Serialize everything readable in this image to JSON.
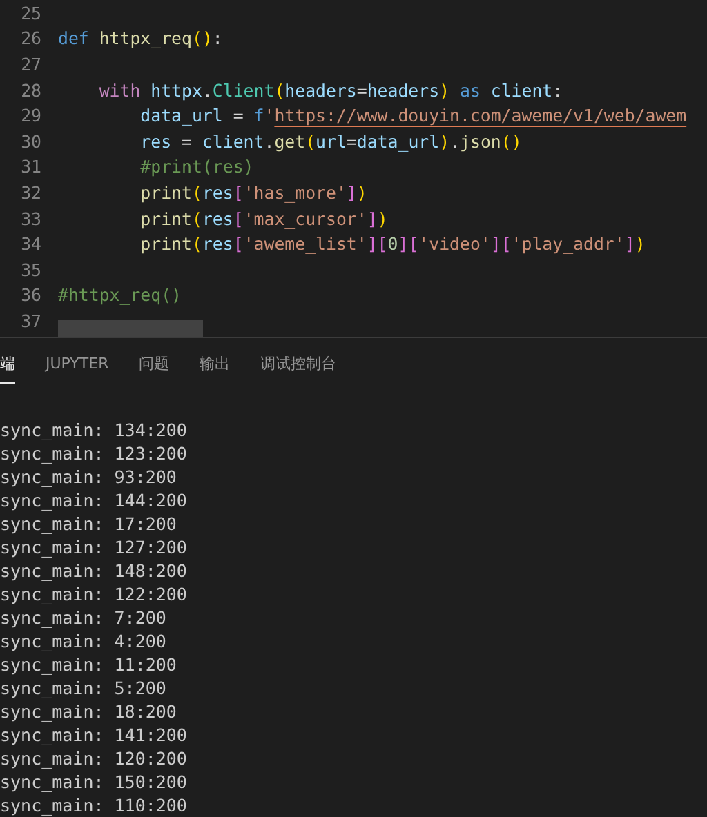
{
  "editor": {
    "lines": [
      {
        "number": "25"
      },
      {
        "number": "26",
        "tokens": [
          {
            "kind": "keyword",
            "text": "def "
          },
          {
            "kind": "function",
            "text": "httpx_req"
          },
          {
            "kind": "paren",
            "text": "()"
          },
          {
            "kind": "plain",
            "text": ":"
          }
        ]
      },
      {
        "number": "27"
      },
      {
        "number": "28",
        "tokens": [
          {
            "kind": "control",
            "text": "    with "
          },
          {
            "kind": "variable",
            "text": "httpx"
          },
          {
            "kind": "plain",
            "text": "."
          },
          {
            "kind": "class",
            "text": "Client"
          },
          {
            "kind": "paren",
            "text": "("
          },
          {
            "kind": "variable",
            "text": "headers"
          },
          {
            "kind": "plain",
            "text": "="
          },
          {
            "kind": "variable",
            "text": "headers"
          },
          {
            "kind": "paren",
            "text": ")"
          },
          {
            "kind": "keyword",
            "text": " as "
          },
          {
            "kind": "variable",
            "text": "client"
          },
          {
            "kind": "plain",
            "text": ":"
          }
        ]
      },
      {
        "number": "29",
        "tokens": [
          {
            "kind": "variable",
            "text": "        data_url"
          },
          {
            "kind": "plain",
            "text": " = "
          },
          {
            "kind": "keyword",
            "text": "f"
          },
          {
            "kind": "string",
            "text": "'"
          },
          {
            "kind": "link",
            "text": "https://www.douyin.com/aweme/v1/web/awem"
          }
        ]
      },
      {
        "number": "30",
        "tokens": [
          {
            "kind": "variable",
            "text": "        res"
          },
          {
            "kind": "plain",
            "text": " = "
          },
          {
            "kind": "variable",
            "text": "client"
          },
          {
            "kind": "plain",
            "text": "."
          },
          {
            "kind": "function",
            "text": "get"
          },
          {
            "kind": "paren",
            "text": "("
          },
          {
            "kind": "variable",
            "text": "url"
          },
          {
            "kind": "plain",
            "text": "="
          },
          {
            "kind": "variable",
            "text": "data_url"
          },
          {
            "kind": "paren",
            "text": ")"
          },
          {
            "kind": "plain",
            "text": "."
          },
          {
            "kind": "function",
            "text": "json"
          },
          {
            "kind": "paren",
            "text": "()"
          }
        ]
      },
      {
        "number": "31",
        "tokens": [
          {
            "kind": "comment",
            "text": "        #print(res)"
          }
        ]
      },
      {
        "number": "32",
        "tokens": [
          {
            "kind": "function",
            "text": "        print"
          },
          {
            "kind": "paren",
            "text": "("
          },
          {
            "kind": "variable",
            "text": "res"
          },
          {
            "kind": "bracket",
            "text": "["
          },
          {
            "kind": "string",
            "text": "'has_more'"
          },
          {
            "kind": "bracket",
            "text": "]"
          },
          {
            "kind": "paren",
            "text": ")"
          }
        ]
      },
      {
        "number": "33",
        "tokens": [
          {
            "kind": "function",
            "text": "        print"
          },
          {
            "kind": "paren",
            "text": "("
          },
          {
            "kind": "variable",
            "text": "res"
          },
          {
            "kind": "bracket",
            "text": "["
          },
          {
            "kind": "string",
            "text": "'max_cursor'"
          },
          {
            "kind": "bracket",
            "text": "]"
          },
          {
            "kind": "paren",
            "text": ")"
          }
        ]
      },
      {
        "number": "34",
        "tokens": [
          {
            "kind": "function",
            "text": "        print"
          },
          {
            "kind": "paren",
            "text": "("
          },
          {
            "kind": "variable",
            "text": "res"
          },
          {
            "kind": "bracket",
            "text": "["
          },
          {
            "kind": "string",
            "text": "'aweme_list'"
          },
          {
            "kind": "bracket",
            "text": "]["
          },
          {
            "kind": "number",
            "text": "0"
          },
          {
            "kind": "bracket",
            "text": "]["
          },
          {
            "kind": "string",
            "text": "'video'"
          },
          {
            "kind": "bracket",
            "text": "]["
          },
          {
            "kind": "string",
            "text": "'play_addr'"
          },
          {
            "kind": "bracket",
            "text": "]"
          },
          {
            "kind": "paren",
            "text": ")"
          }
        ]
      },
      {
        "number": "35"
      },
      {
        "number": "36",
        "tokens": [
          {
            "kind": "comment",
            "text": "#httpx_req()"
          }
        ]
      },
      {
        "number": "37"
      }
    ]
  },
  "panel": {
    "tabs": [
      {
        "label": "端",
        "selected": true
      },
      {
        "label": "JUPYTER",
        "selected": false
      },
      {
        "label": "问题",
        "selected": false
      },
      {
        "label": "输出",
        "selected": false
      },
      {
        "label": "调试控制台",
        "selected": false
      }
    ],
    "output": [
      "sync_main: 134:200",
      "sync_main: 123:200",
      "sync_main: 93:200",
      "sync_main: 144:200",
      "sync_main: 17:200",
      "sync_main: 127:200",
      "sync_main: 148:200",
      "sync_main: 122:200",
      "sync_main: 7:200",
      "sync_main: 4:200",
      "sync_main: 11:200",
      "sync_main: 5:200",
      "sync_main: 18:200",
      "sync_main: 141:200",
      "sync_main: 120:200",
      "sync_main: 150:200",
      "sync_main: 110:200"
    ]
  }
}
